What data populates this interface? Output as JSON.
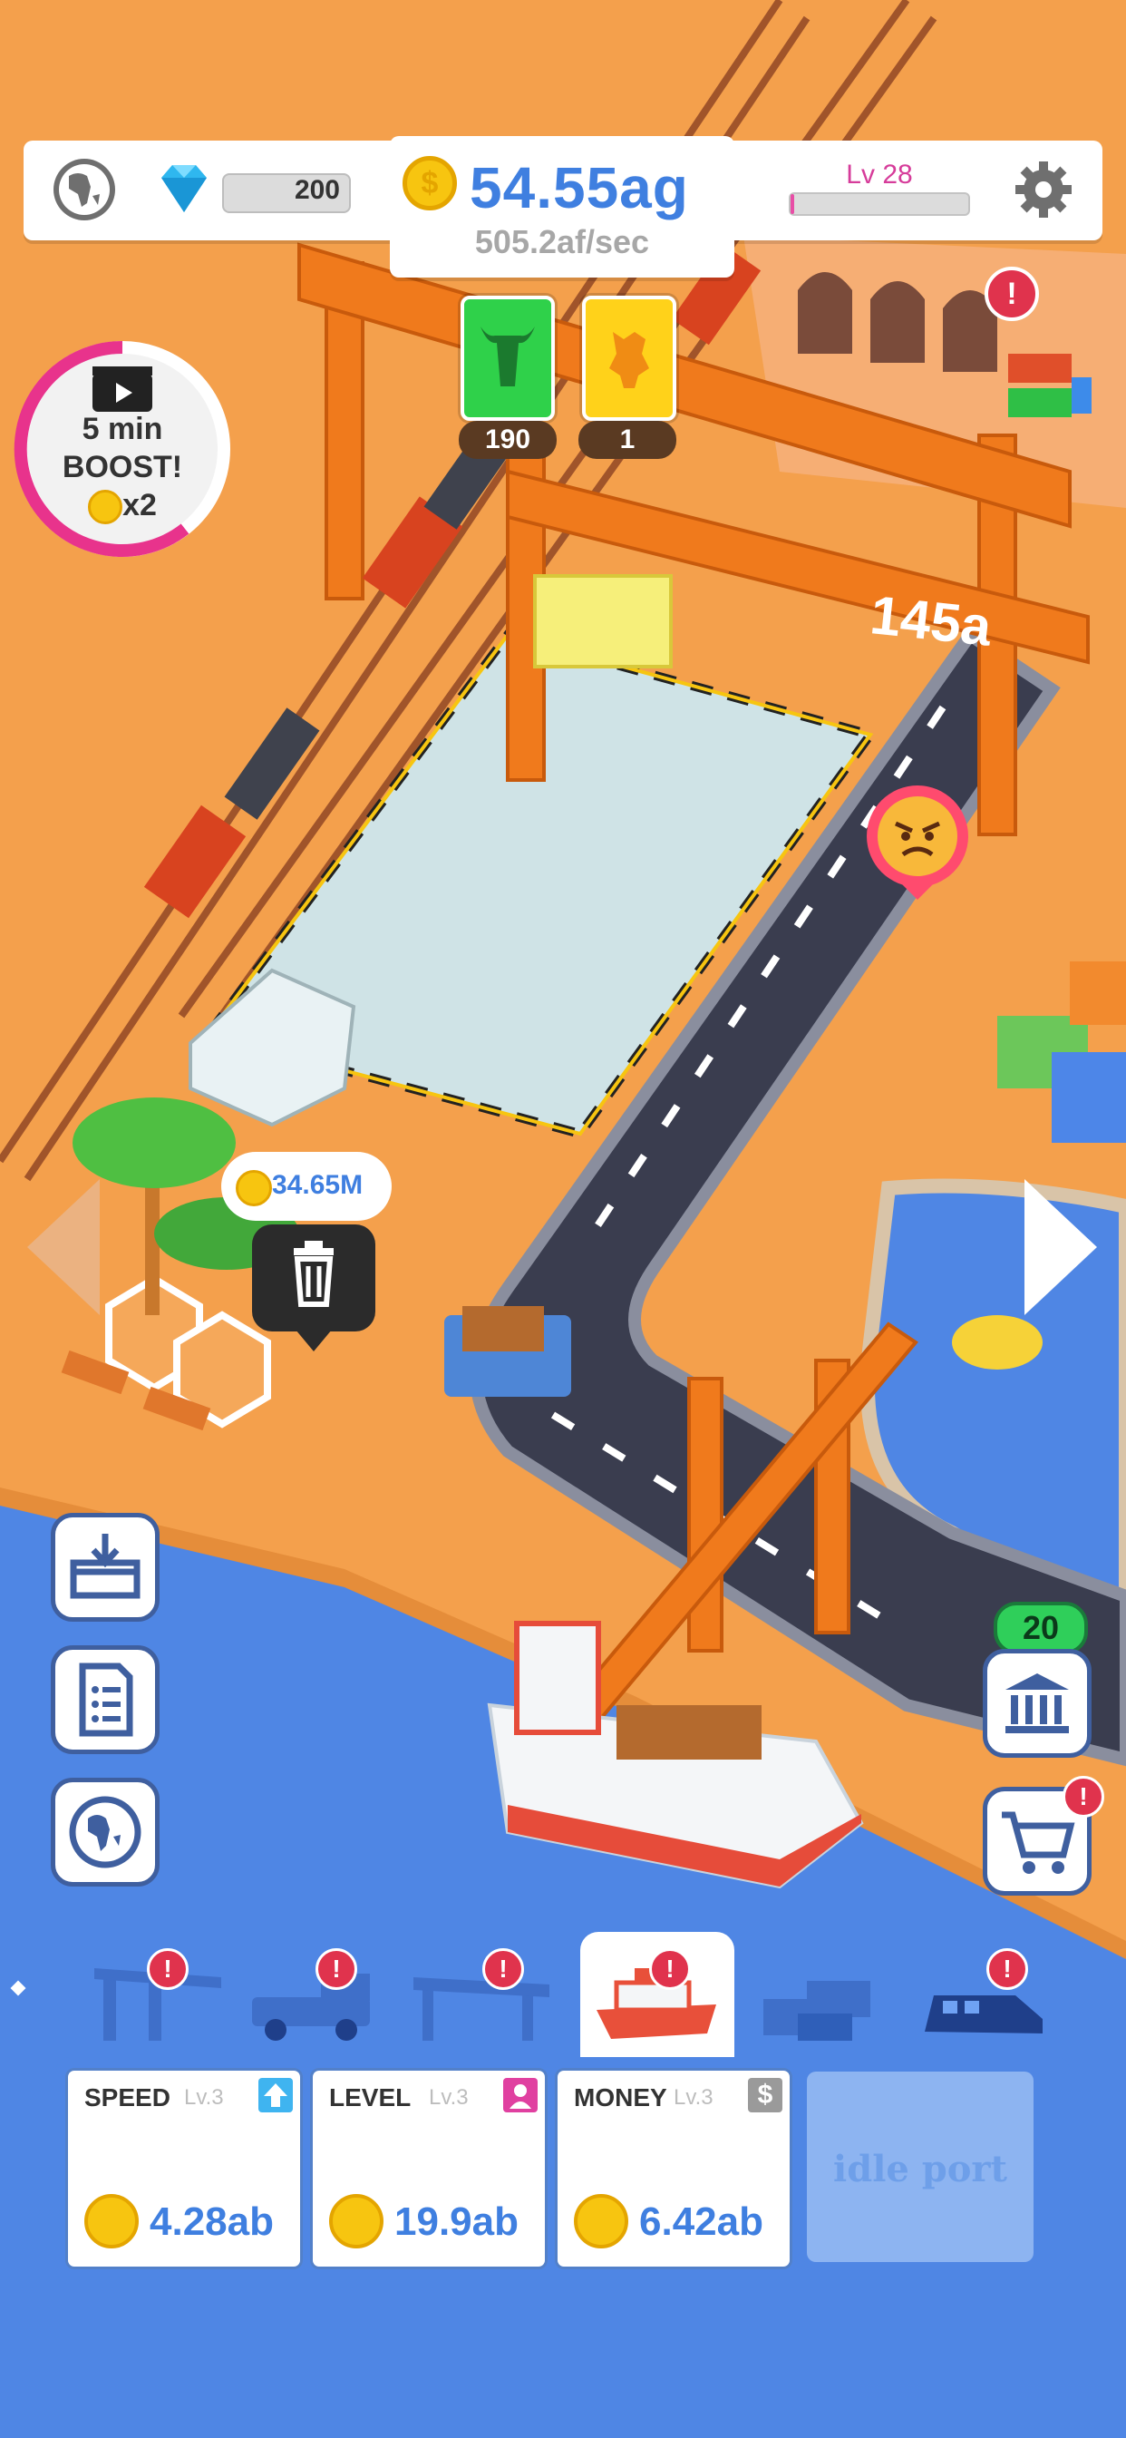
{
  "topbar": {
    "gems": "200",
    "money": "54.55ag",
    "money_rate": "505.2af/sec",
    "level": "Lv 28",
    "level_progress": 0.02
  },
  "resources": [
    {
      "name": "bull-resource",
      "count": "190",
      "color": "#2fd14a"
    },
    {
      "name": "hide-resource",
      "count": "1",
      "color": "#ffd21a"
    }
  ],
  "boost": {
    "line1": "5 min",
    "line2": "BOOST!",
    "line3": "x2"
  },
  "world": {
    "price_bubble": "34.65M",
    "bank_badge": "20",
    "floating_text": "145a"
  },
  "upgrade_cards": [
    {
      "title": "SPEED",
      "level": "Lv.3",
      "price": "4.28ab",
      "tag_color": "#3fb4f0"
    },
    {
      "title": "LEVEL",
      "level": "Lv.3",
      "price": "19.9ab",
      "tag_color": "#e040a0"
    },
    {
      "title": "MONEY",
      "level": "Lv.3",
      "price": "6.42ab",
      "tag_color": "#9a9a9a"
    }
  ],
  "idle_card": {
    "label": "idle port"
  },
  "tabs": [
    {
      "name": "crane-tab",
      "alert": "!"
    },
    {
      "name": "truck-tab",
      "alert": "!"
    },
    {
      "name": "gantry-tab",
      "alert": "!"
    },
    {
      "name": "ship-tab",
      "alert": "!"
    },
    {
      "name": "container-tab",
      "alert": ""
    },
    {
      "name": "train-tab",
      "alert": "!"
    }
  ],
  "colors": {
    "ground": "#f4a04c",
    "water": "#4f86e4",
    "road": "#3a3d4f",
    "accent_blue": "#3f7fe0"
  }
}
